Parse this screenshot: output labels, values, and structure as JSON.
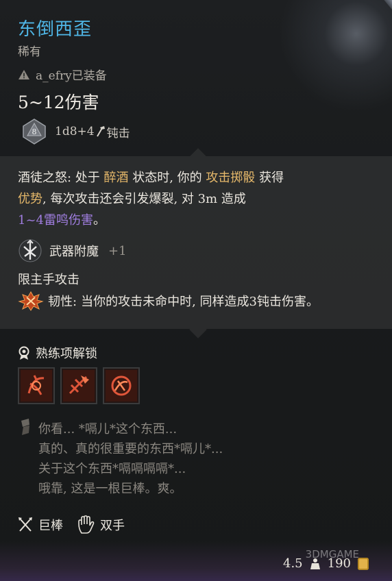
{
  "item": {
    "name": "东倒西歪",
    "rarity": "稀有",
    "equipped_by": "a_efry已装备",
    "damage": "5~12伤害",
    "dice_value": "8",
    "dice_formula": "1d8+4",
    "damage_type": "钝击"
  },
  "effect": {
    "line1_a": "酒徒之怒: 处于 ",
    "line1_b": "醉酒",
    "line1_c": " 状态时, 你的 ",
    "line1_d": "攻击掷骰",
    "line1_e": " 获得",
    "line2_a": "优势",
    "line2_b": ", 每次攻击还会引发爆裂, 对 3m 造成",
    "line3": "1~4雷鸣伤害",
    "line3_end": "。"
  },
  "enchant": {
    "label": "武器附魔",
    "value": "+1"
  },
  "mainhand": "限主手攻击",
  "toughness": {
    "label": "韧性:",
    "text": " 当你的攻击未命中时, 同样造成3钝击伤害。"
  },
  "proficiency": {
    "label": "熟练项解锁",
    "icons": [
      "proficiency-skill-1-icon",
      "proficiency-skill-2-icon",
      "proficiency-skill-3-icon"
    ]
  },
  "flavor": {
    "line1": "你看... *嗝儿*这个东西...",
    "line2": "真的、真的很重要的东西*嗝儿*...",
    "line3": "关于这个东西*嗝嗝嗝嗝*...",
    "line4": "哦靠, 这是一根巨棒。爽。"
  },
  "weapon_types": {
    "type1": "巨棒",
    "type2": "双手"
  },
  "stats": {
    "weight": "4.5",
    "value": "190"
  },
  "watermark": "3DMGAME",
  "colors": {
    "title": "#4fb6e6",
    "highlight": "#e5b86a",
    "thunder": "#a07ee0"
  }
}
